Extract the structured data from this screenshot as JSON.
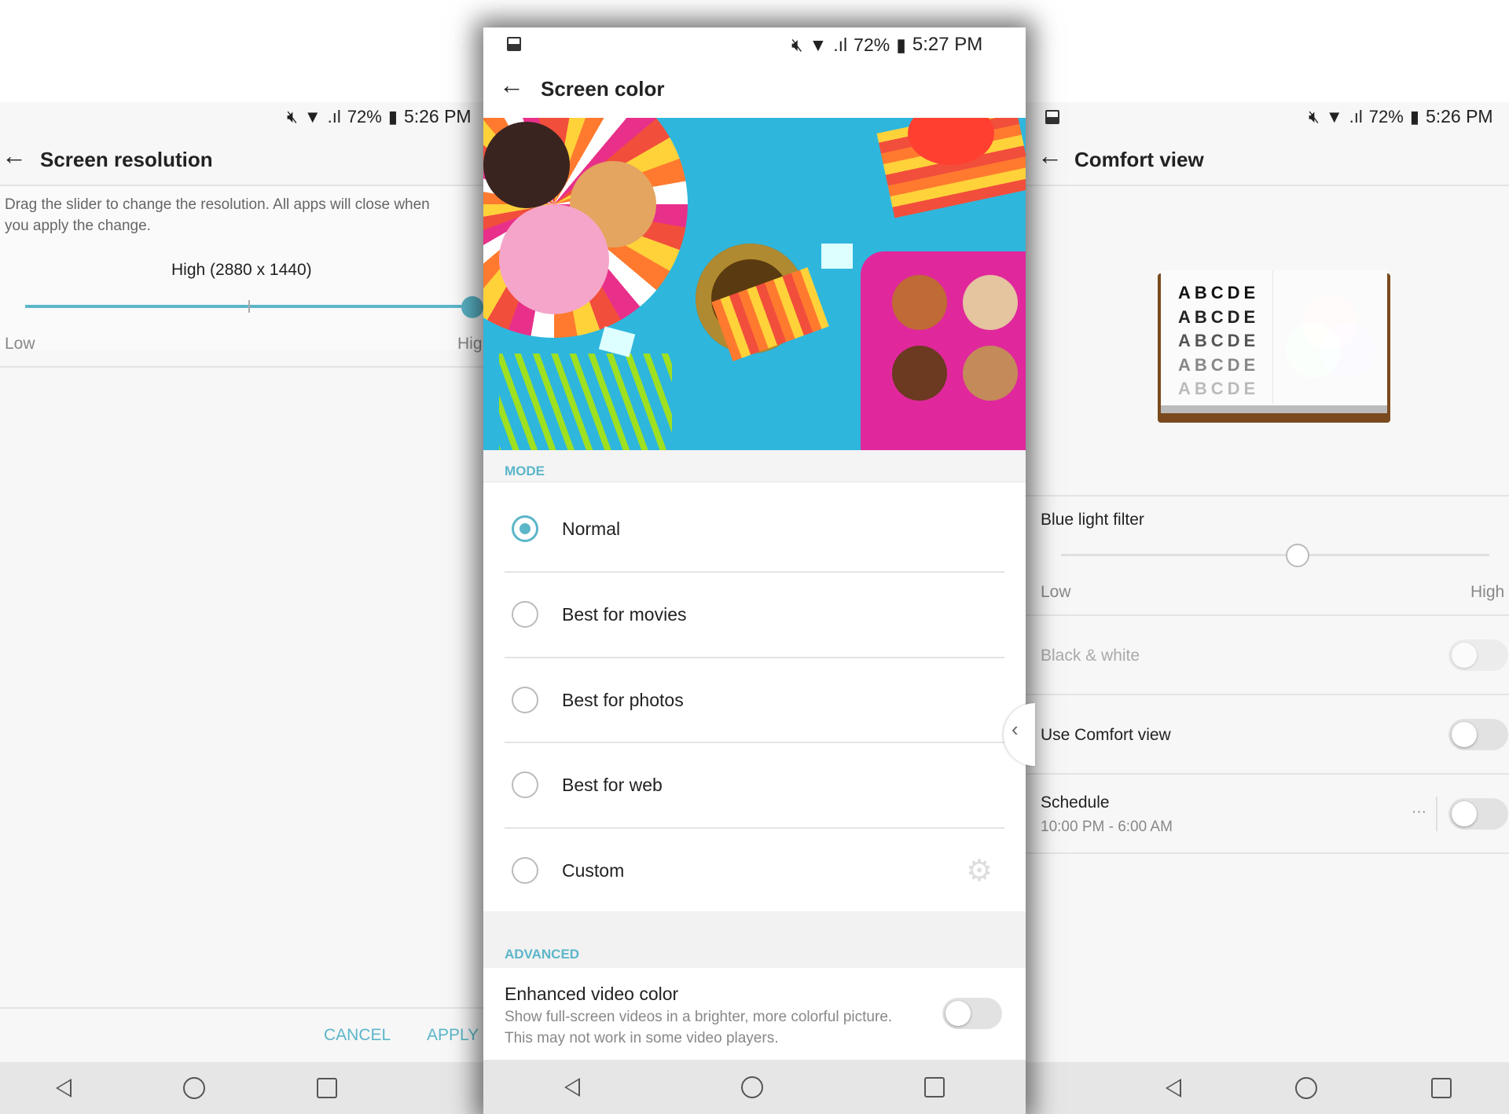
{
  "left": {
    "status": {
      "battery": "72%",
      "time": "5:26 PM"
    },
    "title": "Screen resolution",
    "description_line1": "Drag the slider to change the resolution. All apps will close when",
    "description_line2": "you apply the change.",
    "resolution_label": "High (2880 x 1440)",
    "slider_value_percent": 100,
    "low_label": "Low",
    "high_label": "Hig",
    "cancel": "CANCEL",
    "apply": "APPLY"
  },
  "center": {
    "status": {
      "battery": "72%",
      "time": "5:27 PM"
    },
    "title": "Screen color",
    "mode_header": "MODE",
    "modes": [
      {
        "label": "Normal",
        "selected": true
      },
      {
        "label": "Best for movies",
        "selected": false
      },
      {
        "label": "Best for photos",
        "selected": false
      },
      {
        "label": "Best for web",
        "selected": false
      },
      {
        "label": "Custom",
        "selected": false
      }
    ],
    "advanced_header": "ADVANCED",
    "enhanced": {
      "title": "Enhanced video color",
      "desc1": "Show full-screen videos in a brighter, more colorful picture.",
      "desc2": "This may not work in some video players.",
      "on": false
    }
  },
  "right": {
    "status": {
      "battery": "72%",
      "time": "5:26 PM"
    },
    "title": "Comfort view",
    "chart_letters": "ABCDE",
    "blue_light": {
      "label": "Blue light filter",
      "low": "Low",
      "high": "High",
      "value_percent": 55
    },
    "bw": {
      "label": "Black & white",
      "on": false
    },
    "use": {
      "label": "Use Comfort view",
      "on": false
    },
    "schedule": {
      "label": "Schedule",
      "time": "10:00 PM - 6:00 AM",
      "more": "···",
      "on": false
    }
  },
  "colors": {
    "accent": "#5bb6c9"
  }
}
